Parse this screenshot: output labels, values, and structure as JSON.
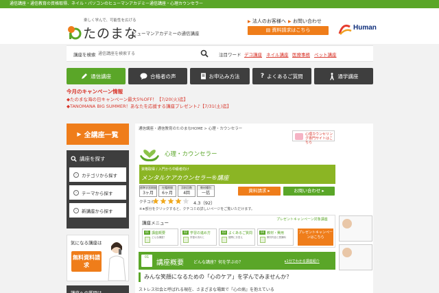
{
  "topbar": {
    "text": "通信講座・通信教育の資格取得、ネイル・パソコンのヒューマンアカデミー通信講座・心理カウンセラー"
  },
  "header": {
    "tagline": "楽しく学んで、可能性を広げる",
    "logo": "たのまな",
    "subtitle": "ヒューマンアカデミーの通信講座",
    "corporate_link": "法人のお客様へ",
    "contact_link": "お問い合わせ",
    "request_button": "資料請求はこちら",
    "brand": "Human"
  },
  "search": {
    "label": "講座を検索",
    "placeholder": "通信講座を検索する",
    "keyword_label": "注目ワード",
    "keywords": [
      "デコ講座",
      "ネイル講座",
      "医療事務",
      "ペット講座"
    ]
  },
  "nav": {
    "items": [
      {
        "label": "通信講座",
        "icon": "pencil-icon"
      },
      {
        "label": "合格者の声",
        "icon": "speech-bubble-icon"
      },
      {
        "label": "お申込み方法",
        "icon": "document-icon"
      },
      {
        "label": "よくあるご質問",
        "icon": "question-icon"
      },
      {
        "label": "通学講座",
        "icon": "walking-person-icon"
      }
    ]
  },
  "campaign": {
    "title": "今月のキャンペーン情報",
    "lines": [
      "◆たのまな海の日キャンペーン最大5%OFF！【7/20(火)迄】",
      "◆TANOMANA BIG SUMMER！あなたを応援する講座プレゼント♪【7/31(土)迄】"
    ]
  },
  "sidebar": {
    "all_courses": "全講座一覧",
    "find_title": "講座を探す",
    "find_items": [
      "カテゴリから探す",
      "テーマから探す",
      "新講座から探す"
    ],
    "promo_title": "気になる講座は",
    "promo_button": "無料資料請求",
    "next_box": "講座への質問は"
  },
  "main": {
    "breadcrumb": "通信講座・通信教育のたのまなHOME > 心理・カウンセラー",
    "counsel_banner": "心理カウンセリング専門サイトはこちら",
    "category": "心理・カウンセラー",
    "course_sub": "資格取得 / 入門から中級者向け",
    "course_name": "メンタルケアカウンセラー®講座",
    "info": [
      {
        "key": "標準学習期間",
        "value": "3ヶ月"
      },
      {
        "key": "在籍期間",
        "value": "6ヶ月"
      },
      {
        "key": "添削回数",
        "value": "4回"
      },
      {
        "key": "教材種別",
        "value": "一括"
      }
    ],
    "doc_button": "資料請求 ▸",
    "ask_button": "お問い合わせ ▸",
    "rating_label": "クチコミ",
    "rating_value": "4.3（92）",
    "rating_note": "※★部分をクリックすると、クチコミの詳しいページをご覧いただけます。",
    "menu_title": "講座メニュー",
    "menu_camp": "プレゼントキャンペーン対象講座",
    "menu_cells": [
      {
        "num": "01",
        "label": "講座概要",
        "desc": "どんな講座？"
      },
      {
        "num": "02",
        "label": "学習の進め方",
        "desc": "学習の流れと"
      },
      {
        "num": "03",
        "label": "よくあるご質問",
        "desc": "疑問にお答え"
      },
      {
        "num": "04",
        "label": "教材・費用",
        "desc": "教材内容と受講料"
      }
    ],
    "present_button": "プレゼントキャンペーンはこちら",
    "section_num": "01",
    "section_title": "講座概要",
    "section_q": "どんな講座？何を学ぶの？",
    "section_link": "▸1分でわかる講座紹介",
    "headline": "みんな笑顔になるための「心のケア」を学んでみませんか？",
    "body": "ストレス社会と呼ばれる現在、さまざまな場面で『心の病』を抱えている"
  },
  "colors": {
    "green": "#5aa628",
    "orange": "#ef7d1a",
    "dark": "#3e3e3e",
    "red": "#d8352a"
  }
}
